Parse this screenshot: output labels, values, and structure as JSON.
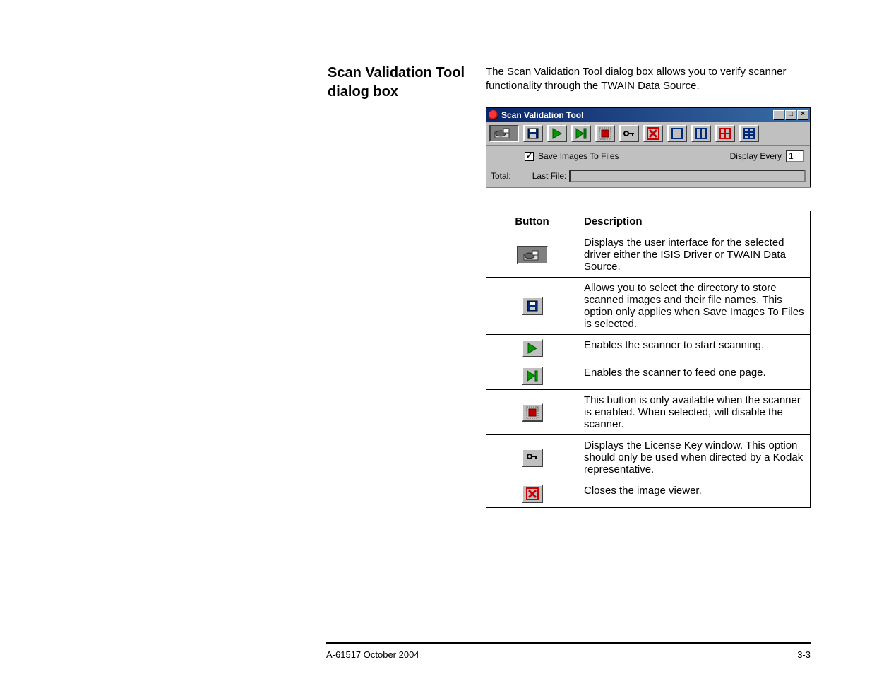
{
  "heading": "Scan Validation Tool dialog box",
  "intro": "The Scan Validation Tool dialog box allows you to verify scanner functionality through the TWAIN Data Source.",
  "dialog": {
    "title": "Scan Validation Tool",
    "minimize_label": "_",
    "maximize_label": "□",
    "close_label": "×",
    "toolbar_icons": [
      "driver-ui-icon",
      "save-destination-icon",
      "start-scan-icon",
      "feed-one-page-icon",
      "stop-disable-icon",
      "license-key-icon",
      "close-viewer-icon",
      "view-1up-icon",
      "view-2up-icon",
      "view-4up-icon",
      "view-8up-icon"
    ],
    "save_images_checked": true,
    "save_images_label": "Save Images To Files",
    "display_every_label": "Display Every",
    "display_every_value": "1",
    "total_label": "Total:",
    "last_file_label": "Last File:"
  },
  "table": {
    "headers": {
      "button": "Button",
      "description": "Description"
    },
    "rows": [
      {
        "icon": "driver-ui-icon",
        "desc": "Displays the user interface for the selected driver either the ISIS Driver or TWAIN Data Source."
      },
      {
        "icon": "save-destination-icon",
        "desc": "Allows you to select the directory to store scanned images and their file names. This option only applies when Save Images To Files is selected."
      },
      {
        "icon": "start-scan-icon",
        "desc": "Enables the scanner to start scanning."
      },
      {
        "icon": "feed-one-page-icon",
        "desc": "Enables the scanner to feed one page."
      },
      {
        "icon": "stop-disable-icon",
        "desc": "This button is only available when the scanner is enabled.  When selected, will disable the scanner."
      },
      {
        "icon": "license-key-icon",
        "desc": "Displays the License Key window.  This option should only be used when directed by a Kodak representative."
      },
      {
        "icon": "close-viewer-icon",
        "desc": "Closes the image viewer."
      }
    ]
  },
  "footer": {
    "left": "A-61517  October 2004",
    "right": "3-3"
  }
}
